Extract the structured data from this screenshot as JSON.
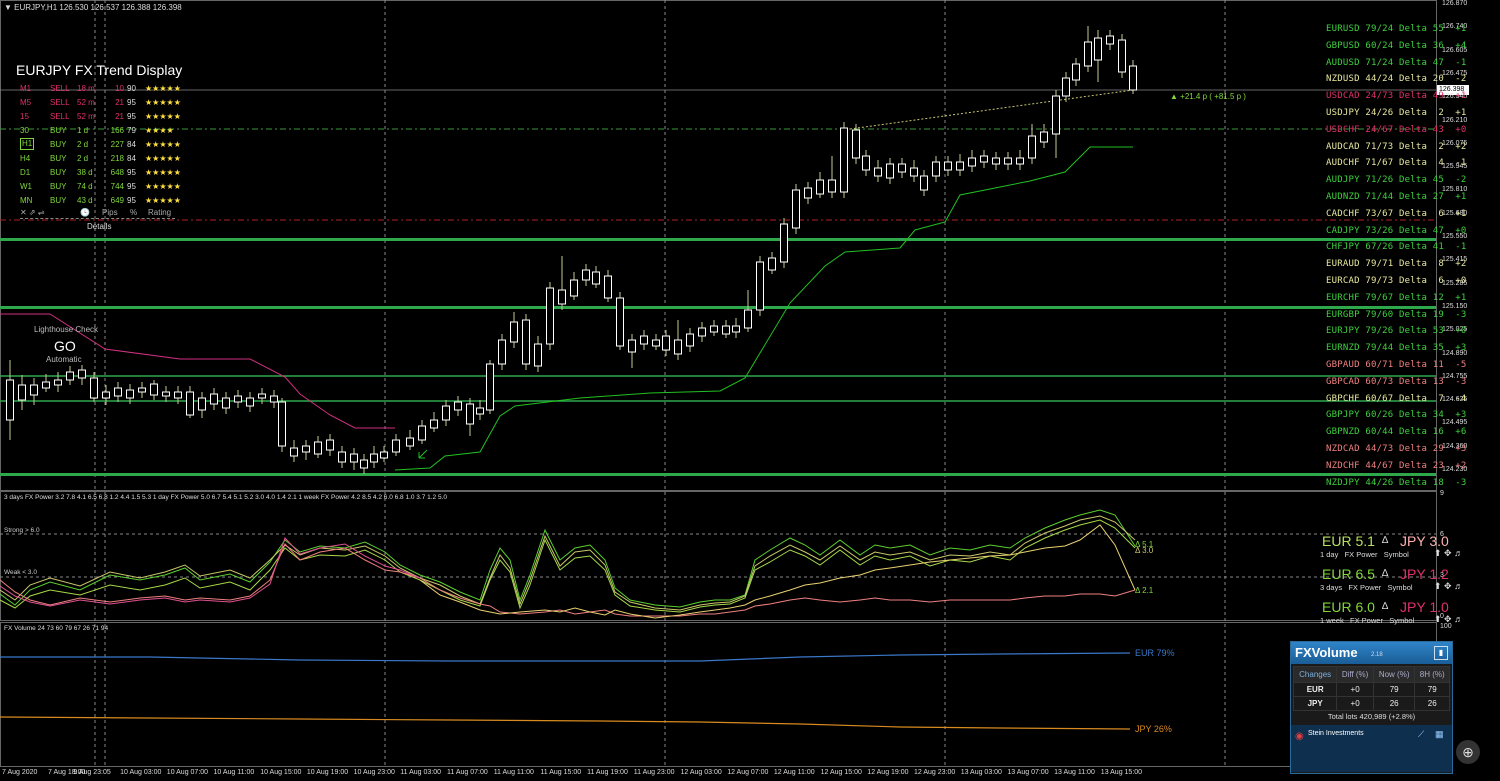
{
  "window": {
    "title": "EURJPY,H1",
    "ohlc": "126.530 126.537 126.388 126.398"
  },
  "trend_display": {
    "title": "EURJPY FX Trend Display",
    "rows": [
      {
        "tf": "M1",
        "dir": "SELL",
        "dur": "18 m",
        "pips": "10",
        "rating": "90",
        "stars": "★★★★★",
        "color": "#e0306a"
      },
      {
        "tf": "M5",
        "dir": "SELL",
        "dur": "52 m",
        "pips": "21",
        "rating": "95",
        "stars": "★★★★★",
        "color": "#e0306a"
      },
      {
        "tf": "15",
        "dir": "SELL",
        "dur": "52 m",
        "pips": "21",
        "rating": "95",
        "stars": "★★★★★",
        "color": "#e0306a"
      },
      {
        "tf": "30",
        "dir": "BUY",
        "dur": "1 d",
        "pips": "166",
        "rating": "79",
        "stars": "★★★★",
        "color": "#7fd83a"
      },
      {
        "tf": "H1",
        "dir": "BUY",
        "dur": "2 d",
        "pips": "227",
        "rating": "84",
        "stars": "★★★★★",
        "color": "#7fd83a"
      },
      {
        "tf": "H4",
        "dir": "BUY",
        "dur": "2 d",
        "pips": "218",
        "rating": "84",
        "stars": "★★★★★",
        "color": "#7fd83a"
      },
      {
        "tf": "D1",
        "dir": "BUY",
        "dur": "38 d",
        "pips": "648",
        "rating": "95",
        "stars": "★★★★★",
        "color": "#7fd83a"
      },
      {
        "tf": "W1",
        "dir": "BUY",
        "dur": "74 d",
        "pips": "744",
        "pips2": "",
        "rating": "95",
        "stars": "★★★★★",
        "color": "#7fd83a"
      },
      {
        "tf": "MN",
        "dir": "BUY",
        "dur": "43 d",
        "pips": "649",
        "rating": "95",
        "stars": "★★★★★",
        "color": "#7fd83a"
      }
    ],
    "footer": {
      "icons": "✕   ⇗   ⇌",
      "clock": "🕓",
      "pips": "Pips",
      "pct": "%",
      "rating": "Rating"
    },
    "details_label": "Details"
  },
  "lighthouse": {
    "label": "Lighthouse Check",
    "status": "GO",
    "mode": "Automatic"
  },
  "price_label": "+21.4 p ( +81.5 p )",
  "current_price": "126.398",
  "price_axis": [
    "126.870",
    "126.740",
    "126.605",
    "126.475",
    "126.340",
    "126.210",
    "126.075",
    "125.945",
    "125.810",
    "125.680",
    "125.550",
    "125.415",
    "125.285",
    "125.150",
    "125.025",
    "124.890",
    "124.755",
    "124.625",
    "124.495",
    "124.360",
    "124.230"
  ],
  "symbols": [
    {
      "text": "EURUSD 79/24 Delta 55  +1",
      "color": "#3fd03f"
    },
    {
      "text": "GBPUSD 60/24 Delta 36  +4",
      "color": "#3fd03f"
    },
    {
      "text": "AUDUSD 71/24 Delta 47  -1",
      "color": "#3fd03f"
    },
    {
      "text": "NZDUSD 44/24 Delta 20  -2",
      "color": "#e8e8a0"
    },
    {
      "text": "USDCAD 24/73 Delta 49  +1",
      "color": "#e0306a"
    },
    {
      "text": "USDJPY 24/26 Delta  2  +1",
      "color": "#e8e8a0"
    },
    {
      "text": "USDCHF 24/67 Delta 43  +0",
      "color": "#e0306a"
    },
    {
      "text": "AUDCAD 71/73 Delta  2  +2",
      "color": "#e8e8a0"
    },
    {
      "text": "AUDCHF 71/67 Delta  4  -1",
      "color": "#e8e8a0"
    },
    {
      "text": "AUDJPY 71/26 Delta 45  -2",
      "color": "#3fd03f"
    },
    {
      "text": "AUDNZD 71/44 Delta 27  +1",
      "color": "#3fd03f"
    },
    {
      "text": "CADCHF 73/67 Delta  6  +1",
      "color": "#e8e8a0"
    },
    {
      "text": "CADJPY 73/26 Delta 47  +0",
      "color": "#3fd03f"
    },
    {
      "text": "CHFJPY 67/26 Delta 41  -1",
      "color": "#3fd03f"
    },
    {
      "text": "EURAUD 79/71 Delta  8  +2",
      "color": "#e8e8a0"
    },
    {
      "text": "EURCAD 79/73 Delta  6  +0",
      "color": "#e8e8a0"
    },
    {
      "text": "EURCHF 79/67 Delta 12  +1",
      "color": "#3fd03f"
    },
    {
      "text": "EURGBP 79/60 Delta 19  -3",
      "color": "#3fd03f"
    },
    {
      "text": "EURJPY 79/26 Delta 53  +0",
      "color": "#3fd03f"
    },
    {
      "text": "EURNZD 79/44 Delta 35  +3",
      "color": "#3fd03f"
    },
    {
      "text": "GBPAUD 60/71 Delta 11  -5",
      "color": "#f08080"
    },
    {
      "text": "GBPCAD 60/73 Delta 13  -3",
      "color": "#f08080"
    },
    {
      "text": "GBPCHF 60/67 Delta  7  -4",
      "color": "#e8e8a0"
    },
    {
      "text": "GBPJPY 60/26 Delta 34  +3",
      "color": "#3fd03f"
    },
    {
      "text": "GBPNZD 60/44 Delta 16  +6",
      "color": "#3fd03f"
    },
    {
      "text": "NZDCAD 44/73 Delta 29  +3",
      "color": "#f08080"
    },
    {
      "text": "NZDCHF 44/67 Delta 23  +2",
      "color": "#f08080"
    },
    {
      "text": "NZDJPY 44/26 Delta 18  -3",
      "color": "#3fd03f"
    }
  ],
  "power": {
    "header": "3 days FX Power 3.2 7.8 4.1 6.5 6.8 1.2 4.4 1.5 5.3   1 day FX Power 5.0 6.7 5.4 5.1 5.2 3.0 4.0 1.4 2.1   1 week FX Power 4.2 8.5 4.2 6.0 6.8 1.0 3.7 1.2 5.0",
    "strong_label": "Strong > 6.0",
    "weak_label": "Weak < 3.0",
    "axis": [
      "9",
      "6",
      "3",
      "0"
    ],
    "delta_labels": [
      "Δ 5.1",
      "Δ 3.0",
      "Δ 2.1"
    ],
    "blocks": [
      {
        "eur": "EUR 5.1",
        "jpy": "JPY 3.0",
        "sub": "1 day   FX Power   Symbol",
        "eur_color": "#b8e060",
        "jpy_color": "#ffb0b0"
      },
      {
        "eur": "EUR 6.5",
        "jpy": "JPY 1.2",
        "sub": "3 days   FX Power   Symbol",
        "eur_color": "#7fd83a",
        "jpy_color": "#e0306a"
      },
      {
        "eur": "EUR 6.0",
        "jpy": "JPY 1.0",
        "sub": "1 week   FX Power   Symbol",
        "eur_color": "#7fd83a",
        "jpy_color": "#e0306a"
      }
    ]
  },
  "volume": {
    "header": "FX Volume 24 73 60 79 67 26 71 94",
    "axis_top": "100",
    "eur_label": "EUR 79%",
    "jpy_label": "JPY 26%",
    "panel": {
      "brand": "FXVolume",
      "version": "2.18",
      "tab": "Changes",
      "cols": [
        "Diff (%)",
        "Now (%)",
        "8H (%)"
      ],
      "rows": [
        {
          "sym": "EUR",
          "diff": "+0",
          "now": "79",
          "h8": "79"
        },
        {
          "sym": "JPY",
          "diff": "+0",
          "now": "26",
          "h8": "26"
        }
      ],
      "total": "Total lots 420,989 (+2.8%)",
      "footer": "Stein Investments"
    }
  },
  "time_axis": [
    "7 Aug 2020",
    "7 Aug 18:00",
    "9 Aug 23:05",
    "10 Aug 03:00",
    "10 Aug 07:00",
    "10 Aug 11:00",
    "10 Aug 15:00",
    "10 Aug 19:00",
    "10 Aug 23:00",
    "11 Aug 03:00",
    "11 Aug 07:00",
    "11 Aug 11:00",
    "11 Aug 15:00",
    "11 Aug 19:00",
    "11 Aug 23:00",
    "12 Aug 03:00",
    "12 Aug 07:00",
    "12 Aug 11:00",
    "12 Aug 15:00",
    "12 Aug 19:00",
    "12 Aug 23:00",
    "13 Aug 03:00",
    "13 Aug 07:00",
    "13 Aug 11:00",
    "13 Aug 15:00"
  ],
  "colors": {
    "bull": "#ffffc0",
    "bear": "#ffffff",
    "wick": "#c8c890",
    "stop_line": "#22c022",
    "pink": "#d03080",
    "grid": "#808080",
    "band": "#2ea84a"
  }
}
